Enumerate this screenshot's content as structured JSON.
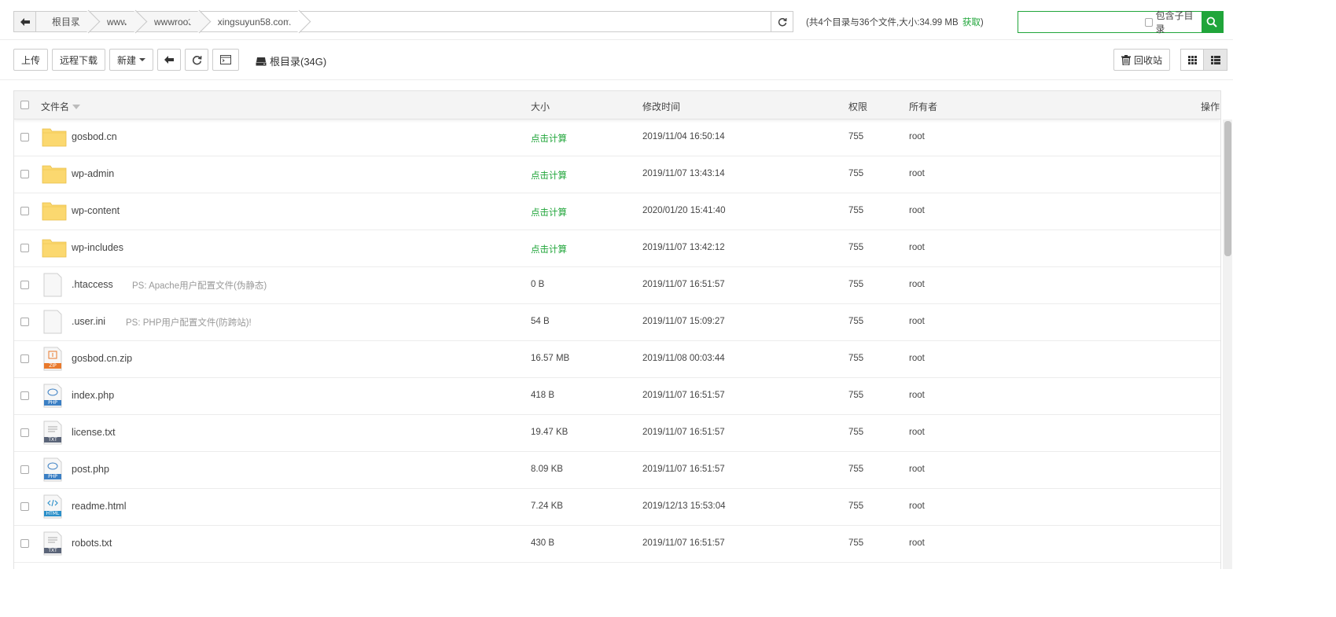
{
  "path": {
    "crumbs": [
      "根目录",
      "www",
      "wwwroot",
      "xingsuyun58.com"
    ]
  },
  "summary": {
    "text": "(共4个目录与36个文件,大小:34.99 MB",
    "link": "获取",
    "close": ")"
  },
  "search": {
    "placeholder": "",
    "subdir_label": "包含子目录"
  },
  "toolbar": {
    "upload": "上传",
    "remote_download": "远程下载",
    "new": "新建",
    "disk_label": "根目录(34G)",
    "recycle": "回收站"
  },
  "table": {
    "headers": {
      "name": "文件名",
      "size": "大小",
      "mtime": "修改时间",
      "perm": "权限",
      "owner": "所有者",
      "actions": "操作"
    },
    "rows": [
      {
        "name": "gosbod.cn",
        "type": "folder",
        "note": "",
        "size": "点击计算",
        "mtime": "2019/11/04 16:50:14",
        "perm": "755",
        "owner": "root"
      },
      {
        "name": "wp-admin",
        "type": "folder",
        "note": "",
        "size": "点击计算",
        "mtime": "2019/11/07 13:43:14",
        "perm": "755",
        "owner": "root"
      },
      {
        "name": "wp-content",
        "type": "folder",
        "note": "",
        "size": "点击计算",
        "mtime": "2020/01/20 15:41:40",
        "perm": "755",
        "owner": "root"
      },
      {
        "name": "wp-includes",
        "type": "folder",
        "note": "",
        "size": "点击计算",
        "mtime": "2019/11/07 13:42:12",
        "perm": "755",
        "owner": "root"
      },
      {
        "name": ".htaccess",
        "type": "blank",
        "note": "PS: Apache用户配置文件(伪静态)",
        "size": "0 B",
        "mtime": "2019/11/07 16:51:57",
        "perm": "755",
        "owner": "root"
      },
      {
        "name": ".user.ini",
        "type": "blank",
        "note": "PS: PHP用户配置文件(防跨站)!",
        "size": "54 B",
        "mtime": "2019/11/07 15:09:27",
        "perm": "755",
        "owner": "root"
      },
      {
        "name": "gosbod.cn.zip",
        "type": "zip",
        "note": "",
        "size": "16.57 MB",
        "mtime": "2019/11/08 00:03:44",
        "perm": "755",
        "owner": "root"
      },
      {
        "name": "index.php",
        "type": "php",
        "note": "",
        "size": "418 B",
        "mtime": "2019/11/07 16:51:57",
        "perm": "755",
        "owner": "root"
      },
      {
        "name": "license.txt",
        "type": "txt",
        "note": "",
        "size": "19.47 KB",
        "mtime": "2019/11/07 16:51:57",
        "perm": "755",
        "owner": "root"
      },
      {
        "name": "post.php",
        "type": "php",
        "note": "",
        "size": "8.09 KB",
        "mtime": "2019/11/07 16:51:57",
        "perm": "755",
        "owner": "root"
      },
      {
        "name": "readme.html",
        "type": "html",
        "note": "",
        "size": "7.24 KB",
        "mtime": "2019/12/13 15:53:04",
        "perm": "755",
        "owner": "root"
      },
      {
        "name": "robots.txt",
        "type": "txt",
        "note": "",
        "size": "430 B",
        "mtime": "2019/11/07 16:51:57",
        "perm": "755",
        "owner": "root"
      }
    ]
  },
  "icon_labels": {
    "zip": "ZIP",
    "php": "PHP",
    "txt": "TXT",
    "html": "HTML"
  },
  "colors": {
    "accent": "#20a53a",
    "folder": "#fbd86f"
  }
}
